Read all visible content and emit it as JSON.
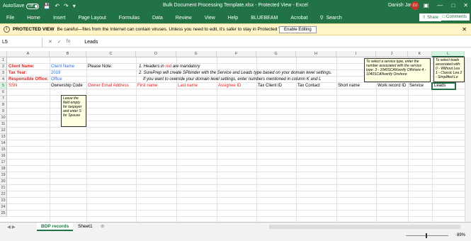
{
  "titlebar": {
    "autosave_label": "AutoSave",
    "autosave_state": "Off",
    "document_title": "Bulk Document Processing Template.xlsx  -  Protected View  -  Excel",
    "user_name": "Danish Javed",
    "user_initials": "DJ"
  },
  "ribbon": {
    "tabs": [
      "File",
      "Home",
      "Insert",
      "Page Layout",
      "Formulas",
      "Data",
      "Review",
      "View",
      "Help",
      "BLUEBEAM",
      "Acrobat"
    ],
    "search_label": "Search",
    "share_label": "Share",
    "comments_label": "Comments"
  },
  "protected_view": {
    "label": "PROTECTED VIEW",
    "message": "Be careful—files from the Internet can contain viruses. Unless you need to edit, it's safer to stay in Protected View.",
    "enable_button": "Enable Editing"
  },
  "formula_bar": {
    "name_box": "L5",
    "fx": "fx",
    "value": "Leads"
  },
  "columns": [
    "A",
    "B",
    "C",
    "D",
    "E",
    "F",
    "G",
    "H",
    "I",
    "J",
    "K",
    "L"
  ],
  "rows": [
    "1",
    "2",
    "3",
    "4",
    "5",
    "6",
    "7",
    "8",
    "9",
    "10",
    "11",
    "12",
    "13",
    "14",
    "15",
    "16",
    "17",
    "18",
    "19",
    "20",
    "21",
    "22",
    "23",
    "24",
    "25"
  ],
  "cells": {
    "a2": "Client Name:",
    "b2": "Client Name",
    "c2": "Please Note:",
    "d2": "1. Headers in",
    "d2_red": "red",
    "d2_rest": "are mandatory",
    "a3": "Tax Year:",
    "b3": "2019",
    "d3": "2. SurePrep will create SPbinder with the Service and Leads type based on your domain level settings.",
    "a4": "Responsible Office:",
    "b4": "Office",
    "d4": "If you want to override your domain level settings, enter numbers mentioned in column K and L",
    "a5": "SSN",
    "b5": "Ownership Code",
    "c5": "Owner Email Address",
    "d5": "First name",
    "e5": "Last name",
    "f5": "Assignee ID",
    "g5": "Tax Client ID",
    "h5": "Tax Contact",
    "i5": "Short name",
    "j5": "Work record ID",
    "k5": "Service",
    "l5": "Leads"
  },
  "notes": {
    "ownership": "Leave the field empty for taxpayer and enter S for Spouse",
    "service": "To select a service type, enter the number associated with the service type: 3 - 1040SCANverify Offshore 4 - 1040SCANverify Onshore",
    "leads": "To select leads associated with: 0 - Without Lea 1 - Classic Lea 2 - Simplified Le"
  },
  "sheets": [
    "BDP records",
    "Sheet1"
  ],
  "status": {
    "zoom": "89%"
  },
  "colors": {
    "excel_green": "#217346",
    "header_red": "#e02020",
    "value_blue": "#2f6fd6",
    "protected_yellow": "#fff5c7"
  }
}
